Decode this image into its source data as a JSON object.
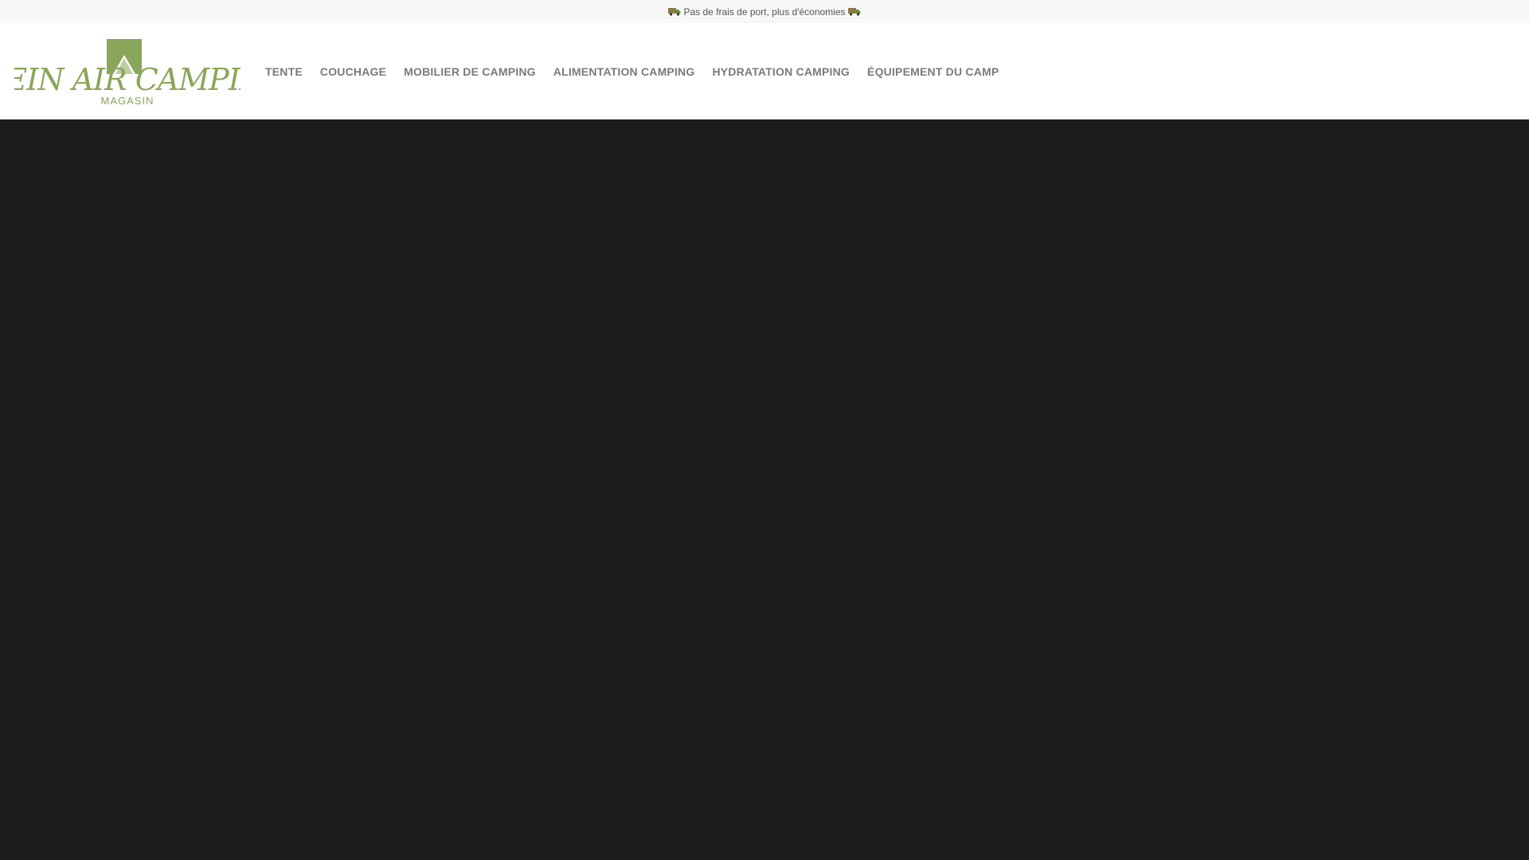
{
  "topbar": {
    "message": "Pas de frais de port, plus d'économies",
    "icon": "truck-icon"
  },
  "logo": {
    "line1": "PLEIN AIR CAMPING",
    "line2": "MAGASIN",
    "color": "#8aa65a"
  },
  "nav": {
    "items": [
      {
        "label": "TENTE"
      },
      {
        "label": "COUCHAGE"
      },
      {
        "label": "MOBILIER DE CAMPING"
      },
      {
        "label": "ALIMENTATION CAMPING"
      },
      {
        "label": "HYDRATATION CAMPING"
      },
      {
        "label": "ÉQUIPEMENT DU CAMP"
      }
    ]
  },
  "colors": {
    "topbar_bg": "#f7f7f7",
    "header_bg": "#ffffff",
    "main_bg": "#1c1c1c",
    "nav_text": "#7a7a7a",
    "brand_green": "#8aa65a"
  }
}
